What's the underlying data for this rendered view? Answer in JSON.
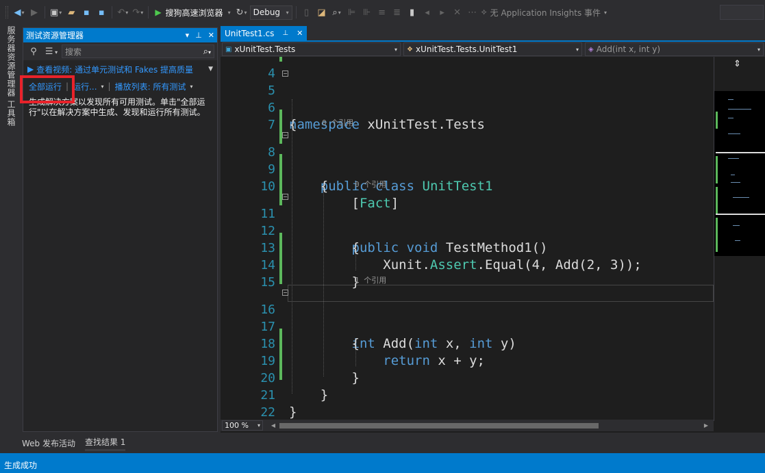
{
  "toolbar": {
    "run_target": "搜狗高速浏览器",
    "config": "Debug",
    "insights": "无 Application Insights 事件"
  },
  "side_strip": {
    "tab1": "服务器资源管理器",
    "tab2": "工具箱"
  },
  "test_explorer": {
    "title": "测试资源管理器",
    "search_placeholder": "搜索",
    "video_link": "查看视频: 通过单元测试和 Fakes 提高质量",
    "run_all": "全部运行",
    "run": "运行...",
    "playlist": "播放列表: 所有测试",
    "message": "生成解决方案以发现所有可用测试。单击\"全部运行\"以在解决方案中生成、发现和运行所有测试。"
  },
  "editor": {
    "tab_name": "UnitTest1.cs",
    "nav_project": "xUnitTest.Tests",
    "nav_class": "xUnitTest.Tests.UnitTest1",
    "nav_member": "Add(int x, int y)",
    "zoom": "100 %",
    "lens_zero": "0 个引用",
    "lens_one": "1 个引用",
    "line_numbers": [
      "4",
      "5",
      "6",
      "7",
      "8",
      "9",
      "10",
      "11",
      "12",
      "13",
      "14",
      "15",
      "16",
      "17",
      "18",
      "19",
      "20",
      "21",
      "22"
    ]
  },
  "bottom_tabs": {
    "tab1": "Web 发布活动",
    "tab2": "查找结果 1"
  },
  "status": {
    "text": "生成成功"
  },
  "colors": {
    "accent": "#007acc",
    "keyword": "#569cd6",
    "type": "#4ec9b0",
    "line_number": "#2b91af",
    "change_bar": "#5cb85c",
    "highlight": "#e8222a"
  }
}
